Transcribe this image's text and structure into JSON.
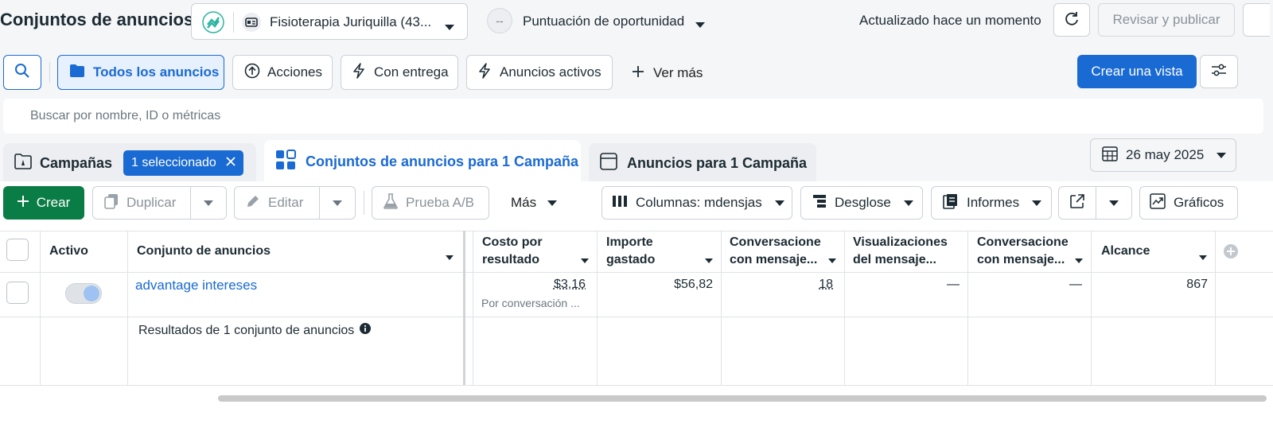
{
  "header": {
    "title": "Conjuntos de anuncios",
    "account_name": "Fisioterapia Juriquilla (43...",
    "opportunity_score_value": "--",
    "opportunity_score_label": "Puntuación de oportunidad",
    "status_text": "Actualizado hace un momento",
    "publish_label": "Revisar y publicar"
  },
  "filters": {
    "all_ads": "Todos los anuncios",
    "actions": "Acciones",
    "with_delivery": "Con entrega",
    "active_ads": "Anuncios activos",
    "see_more": "Ver más",
    "create_view": "Crear una vista"
  },
  "search": {
    "placeholder": "Buscar por nombre, ID o métricas"
  },
  "tabs": {
    "campaigns": "Campañas",
    "selected_badge": "1 seleccionado",
    "adsets": "Conjuntos de anuncios para 1 Campaña",
    "ads": "Anuncios para 1 Campaña",
    "date": "26 may 2025"
  },
  "toolbar": {
    "create": "Crear",
    "duplicate": "Duplicar",
    "edit": "Editar",
    "ab_test": "Prueba A/B",
    "more": "Más",
    "columns": "Columnas: mdensjas",
    "breakdown": "Desglose",
    "reports": "Informes",
    "charts": "Gráficos"
  },
  "table": {
    "headers": {
      "active": "Activo",
      "adset": "Conjunto de anuncios",
      "cost_per_result": [
        "Costo por",
        "resultado"
      ],
      "amount_spent": [
        "Importe",
        "gastado"
      ],
      "conversations": [
        "Conversacione",
        "con mensaje..."
      ],
      "views": [
        "Visualizaciones",
        "del mensaje..."
      ],
      "conversations2": [
        "Conversacione",
        "con mensaje..."
      ],
      "reach": "Alcance"
    },
    "rows": [
      {
        "name": "advantage intereses",
        "cost_per_result": "$3,16",
        "cost_per_result_sub": "Por conversación ...",
        "amount_spent": "$56,82",
        "conversations": "18",
        "views": "—",
        "conversations2": "—",
        "reach": "867",
        "active": true
      }
    ],
    "summary": "Resultados de 1 conjunto de anuncios"
  },
  "colors": {
    "accent": "#1a6ad3",
    "create": "#0a7c45",
    "badge": "#1a6ad3"
  }
}
